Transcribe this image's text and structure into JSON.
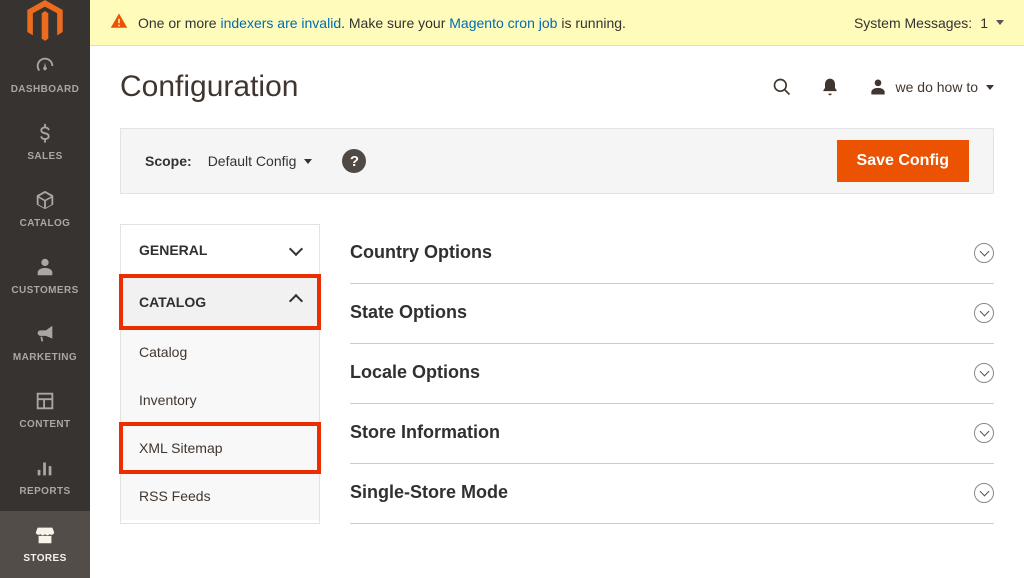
{
  "sidebar": {
    "items": [
      {
        "label": "DASHBOARD"
      },
      {
        "label": "SALES"
      },
      {
        "label": "CATALOG"
      },
      {
        "label": "CUSTOMERS"
      },
      {
        "label": "MARKETING"
      },
      {
        "label": "CONTENT"
      },
      {
        "label": "REPORTS"
      },
      {
        "label": "STORES"
      }
    ]
  },
  "system_message": {
    "prefix": "One or more ",
    "link1": "indexers are invalid",
    "middle": ". Make sure your ",
    "link2": "Magento cron job",
    "suffix": " is running.",
    "counter_label": "System Messages:",
    "counter_value": "1"
  },
  "header": {
    "title": "Configuration",
    "user_name": "we do how to"
  },
  "toolbar": {
    "scope_label": "Scope:",
    "scope_value": "Default Config",
    "help_glyph": "?",
    "save_label": "Save Config"
  },
  "config_nav": {
    "sections": [
      {
        "label": "GENERAL",
        "expanded": false
      },
      {
        "label": "CATALOG",
        "expanded": true
      }
    ],
    "catalog_items": [
      "Catalog",
      "Inventory",
      "XML Sitemap",
      "RSS Feeds"
    ]
  },
  "panes": [
    "Country Options",
    "State Options",
    "Locale Options",
    "Store Information",
    "Single-Store Mode"
  ]
}
